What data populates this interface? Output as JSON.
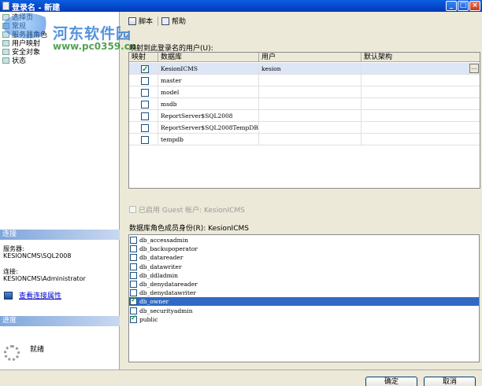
{
  "window": {
    "title": "登录名 - 新建",
    "minimize": "_",
    "maximize": "□",
    "close": "×"
  },
  "watermark": {
    "title": "河东软件园",
    "url": "www.pc0359.cn"
  },
  "sidebar": {
    "items": [
      {
        "label": "选择页",
        "icon": "page-icon"
      },
      {
        "label": "常规",
        "icon": "page-icon"
      },
      {
        "label": "服务器角色",
        "icon": "page-icon"
      },
      {
        "label": "用户映射",
        "icon": "page-icon"
      },
      {
        "label": "安全对象",
        "icon": "page-icon"
      },
      {
        "label": "状态",
        "icon": "page-icon"
      }
    ],
    "connection": {
      "header": "连接",
      "server_label": "服务器:",
      "server_value": "KESIONCMS\\SQL2008",
      "conn_label": "连接:",
      "conn_value": "KESIONCMS\\Administrator",
      "link": "查看连接属性"
    },
    "progress": {
      "header": "进度",
      "status": "就绪"
    }
  },
  "toolbar": {
    "script": "脚本",
    "help": "帮助"
  },
  "mapping": {
    "label": "映射到此登录名的用户(U):",
    "columns": [
      "映射",
      "数据库",
      "用户",
      "默认架构"
    ],
    "rows": [
      {
        "mapped": true,
        "database": "KesionICMS",
        "user": "kesion",
        "schema": ""
      },
      {
        "mapped": false,
        "database": "master",
        "user": "",
        "schema": ""
      },
      {
        "mapped": false,
        "database": "model",
        "user": "",
        "schema": ""
      },
      {
        "mapped": false,
        "database": "msdb",
        "user": "",
        "schema": ""
      },
      {
        "mapped": false,
        "database": "ReportServer$SQL2008",
        "user": "",
        "schema": ""
      },
      {
        "mapped": false,
        "database": "ReportServer$SQL2008TempDB",
        "user": "",
        "schema": ""
      },
      {
        "mapped": false,
        "database": "tempdb",
        "user": "",
        "schema": ""
      }
    ],
    "browse": "..."
  },
  "guest": "已启用 Guest 帐户: KesionICMS",
  "roles": {
    "label": "数据库角色成员身份(R): KesionICMS",
    "items": [
      {
        "name": "db_accessadmin",
        "checked": false
      },
      {
        "name": "db_backupoperator",
        "checked": false
      },
      {
        "name": "db_datareader",
        "checked": false
      },
      {
        "name": "db_datawriter",
        "checked": false
      },
      {
        "name": "db_ddladmin",
        "checked": false
      },
      {
        "name": "db_denydatareader",
        "checked": false
      },
      {
        "name": "db_denydatawriter",
        "checked": false
      },
      {
        "name": "db_owner",
        "checked": true,
        "selected": true
      },
      {
        "name": "db_securityadmin",
        "checked": false
      },
      {
        "name": "public",
        "checked": true
      }
    ]
  },
  "buttons": {
    "ok": "确定",
    "cancel": "取消"
  }
}
